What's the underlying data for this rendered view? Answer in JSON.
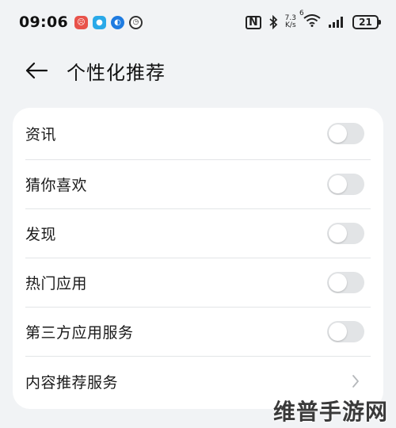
{
  "status_bar": {
    "time": "09:06",
    "net_speed_value": "7.3",
    "net_speed_unit": "K/s",
    "wifi_label": "6",
    "battery": "21"
  },
  "header": {
    "title": "个性化推荐",
    "back_icon": "arrow-left-icon"
  },
  "settings": {
    "items": [
      {
        "label": "资讯",
        "type": "toggle",
        "on": false
      },
      {
        "label": "猜你喜欢",
        "type": "toggle",
        "on": false
      },
      {
        "label": "发现",
        "type": "toggle",
        "on": false
      },
      {
        "label": "热门应用",
        "type": "toggle",
        "on": false
      },
      {
        "label": "第三方应用服务",
        "type": "toggle",
        "on": false
      },
      {
        "label": "内容推荐服务",
        "type": "link",
        "icon": "chevron-right-icon"
      }
    ]
  },
  "watermark": "维普手游网",
  "colors": {
    "background": "#f1f3f5",
    "card": "#ffffff",
    "toggle_off": "#e2e4e6",
    "divider": "#e3e5e7"
  }
}
